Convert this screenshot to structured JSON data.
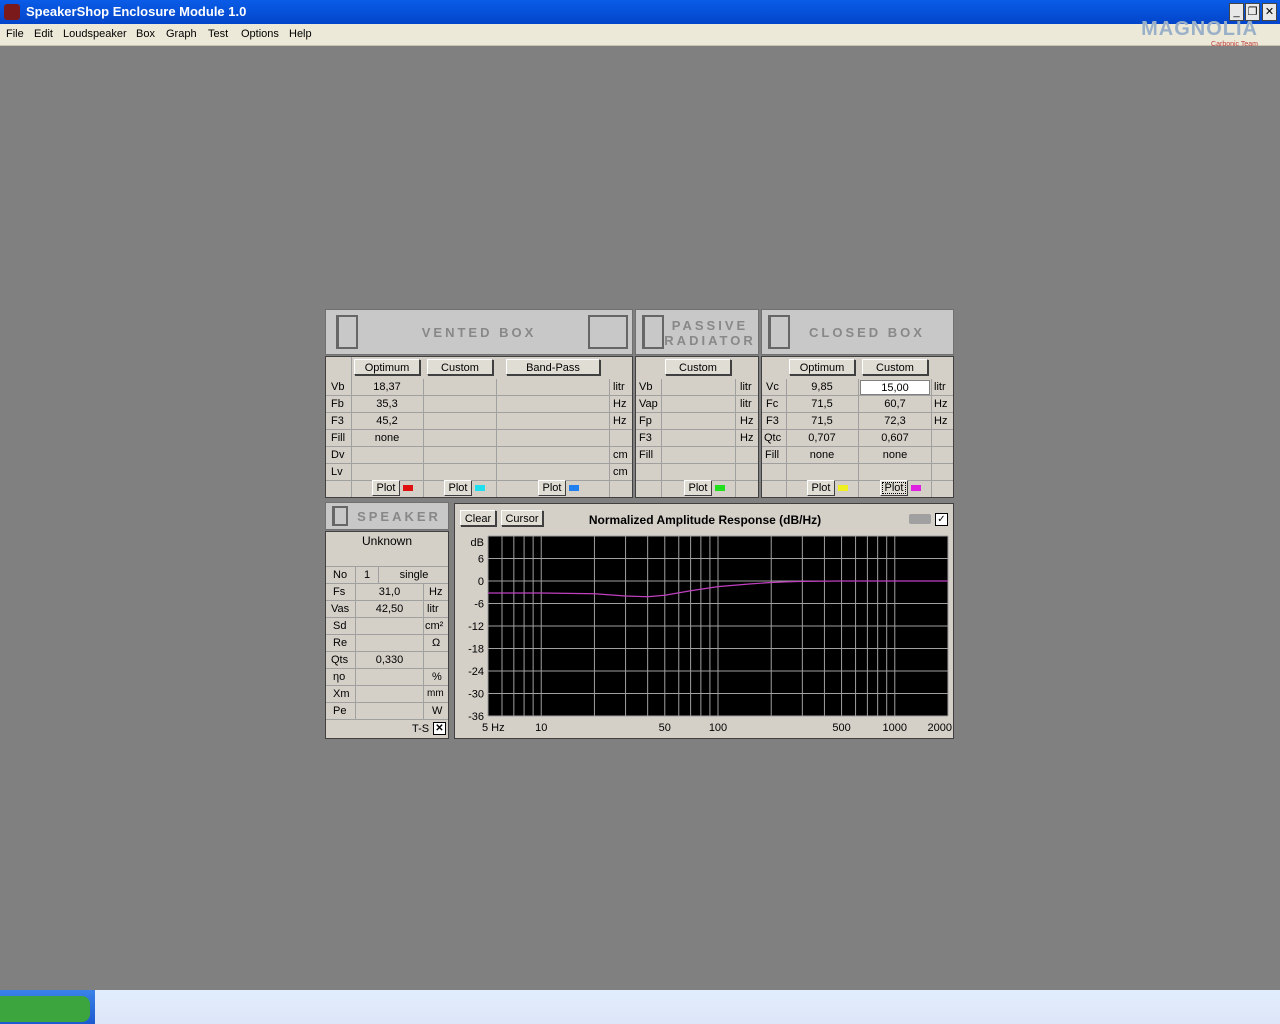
{
  "window": {
    "title": "SpeakerShop Enclosure Module 1.0",
    "min": "_",
    "restore": "❐",
    "close": "✕"
  },
  "menu": [
    "File",
    "Edit",
    "Loudspeaker",
    "Box",
    "Graph",
    "Test",
    "Options",
    "Help"
  ],
  "watermark": {
    "main": "MAGNOLIA",
    "sub": "Carbonic Team"
  },
  "vented": {
    "header": "VENTED BOX",
    "buttons": [
      "Optimum",
      "Custom",
      "Band-Pass"
    ],
    "rows": [
      {
        "label": "Vb",
        "unit": "litr",
        "values": [
          "18,37",
          "",
          ""
        ]
      },
      {
        "label": "Fb",
        "unit": "Hz",
        "values": [
          "35,3",
          "",
          ""
        ]
      },
      {
        "label": "F3",
        "unit": "Hz",
        "values": [
          "45,2",
          "",
          ""
        ]
      },
      {
        "label": "Fill",
        "unit": "",
        "values": [
          "none",
          "",
          ""
        ]
      },
      {
        "label": "Dv",
        "unit": "cm",
        "values": [
          "",
          "",
          ""
        ]
      },
      {
        "label": "Lv",
        "unit": "cm",
        "values": [
          "",
          "",
          ""
        ]
      }
    ],
    "plot_label": "Plot",
    "plot_colors": [
      "#e01010",
      "#20e0f0",
      "#2080f0"
    ]
  },
  "passive": {
    "header_line1": "PASSIVE",
    "header_line2": "RADIATOR",
    "button": "Custom",
    "rows": [
      {
        "label": "Vb",
        "unit": "litr",
        "value": ""
      },
      {
        "label": "Vap",
        "unit": "litr",
        "value": ""
      },
      {
        "label": "Fp",
        "unit": "Hz",
        "value": ""
      },
      {
        "label": "F3",
        "unit": "Hz",
        "value": ""
      },
      {
        "label": "Fill",
        "unit": "",
        "value": ""
      }
    ],
    "plot_label": "Plot",
    "plot_color": "#20e020"
  },
  "closed": {
    "header": "CLOSED BOX",
    "buttons": [
      "Optimum",
      "Custom"
    ],
    "rows": [
      {
        "label": "Vc",
        "unit": "litr",
        "values": [
          "9,85",
          "15,00"
        ]
      },
      {
        "label": "Fc",
        "unit": "Hz",
        "values": [
          "71,5",
          "60,7"
        ]
      },
      {
        "label": "F3",
        "unit": "Hz",
        "values": [
          "71,5",
          "72,3"
        ]
      },
      {
        "label": "Qtc",
        "unit": "",
        "values": [
          "0,707",
          "0,607"
        ]
      },
      {
        "label": "Fill",
        "unit": "",
        "values": [
          "none",
          "none"
        ]
      }
    ],
    "plot_label": "Plot",
    "plot_colors": [
      "#f0f020",
      "#e020e0"
    ]
  },
  "speaker": {
    "header": "SPEAKER",
    "name": "Unknown",
    "no_label": "No",
    "no_value": "1",
    "mode": "single",
    "rows": [
      {
        "label": "Fs",
        "value": "31,0",
        "unit": "Hz"
      },
      {
        "label": "Vas",
        "value": "42,50",
        "unit": "litr"
      },
      {
        "label": "Sd",
        "value": "",
        "unit": "cm²"
      },
      {
        "label": "Re",
        "value": "",
        "unit": "Ω"
      },
      {
        "label": "Qts",
        "value": "0,330",
        "unit": ""
      },
      {
        "label": "ηo",
        "value": "",
        "unit": "%"
      },
      {
        "label": "Xm",
        "value": "",
        "unit": "mm"
      },
      {
        "label": "Pe",
        "value": "",
        "unit": "W"
      }
    ],
    "ts_label": "T-S"
  },
  "graph": {
    "clear": "Clear",
    "cursor": "Cursor",
    "title": "Normalized Amplitude Response (dB/Hz)"
  },
  "chart_data": {
    "type": "line",
    "title": "Normalized Amplitude Response (dB/Hz)",
    "ylabel": "dB",
    "y_ticks": [
      "6",
      "0",
      "-6",
      "-12",
      "-18",
      "-24",
      "-30",
      "-36"
    ],
    "x_tick_labels": [
      "5 Hz",
      "10",
      "50",
      "100",
      "500",
      "1000",
      "2000"
    ],
    "x_scale": "log",
    "xlim": [
      5,
      2000
    ],
    "ylim": [
      -36,
      12
    ],
    "grid": true,
    "series": [
      {
        "color": "#c040c0",
        "x": [
          5,
          10,
          20,
          30,
          40,
          50,
          70,
          100,
          150,
          200,
          250,
          300,
          500,
          1000,
          2000
        ],
        "y": [
          -3.2,
          -3.2,
          -3.4,
          -4.0,
          -4.2,
          -3.8,
          -2.6,
          -1.5,
          -0.8,
          -0.4,
          -0.2,
          -0.1,
          0,
          0,
          0
        ]
      }
    ]
  }
}
